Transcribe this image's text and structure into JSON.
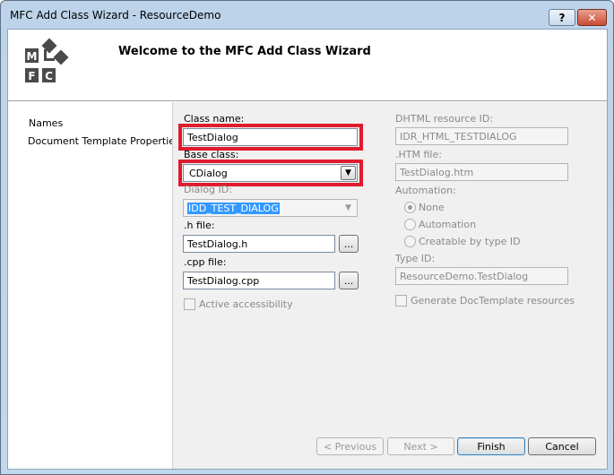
{
  "window": {
    "title": "MFC Add Class Wizard - ResourceDemo",
    "help_label": "?",
    "close_label": "✕"
  },
  "header": {
    "title": "Welcome to the MFC Add Class Wizard",
    "logo_letters": [
      "M",
      "F",
      "C"
    ]
  },
  "nav": {
    "items": [
      "Names",
      "Document Template Properties"
    ]
  },
  "form": {
    "class_name_label": "Class name:",
    "class_name_value": "TestDialog",
    "base_class_label": "Base class:",
    "base_class_value": "CDialog",
    "dialog_id_label": "Dialog ID:",
    "dialog_id_value": "IDD_TEST_DIALOG",
    "h_file_label": ".h file:",
    "h_file_value": "TestDialog.h",
    "cpp_file_label": ".cpp file:",
    "cpp_file_value": "TestDialog.cpp",
    "browse_label": "...",
    "accessibility_label": "Active accessibility",
    "dhtml_id_label": "DHTML resource ID:",
    "dhtml_id_value": "IDR_HTML_TESTDIALOG",
    "htm_file_label": ".HTM file:",
    "htm_file_value": "TestDialog.htm",
    "automation_label": "Automation:",
    "automation_options": [
      "None",
      "Automation",
      "Creatable by type ID"
    ],
    "automation_selected": "None",
    "type_id_label": "Type ID:",
    "type_id_value": "ResourceDemo.TestDialog",
    "doctemplate_label": "Generate DocTemplate resources"
  },
  "buttons": {
    "previous": "< Previous",
    "next": "Next >",
    "finish": "Finish",
    "cancel": "Cancel"
  },
  "colors": {
    "highlight_box": "#e01b2d",
    "selection": "#3399ff"
  }
}
